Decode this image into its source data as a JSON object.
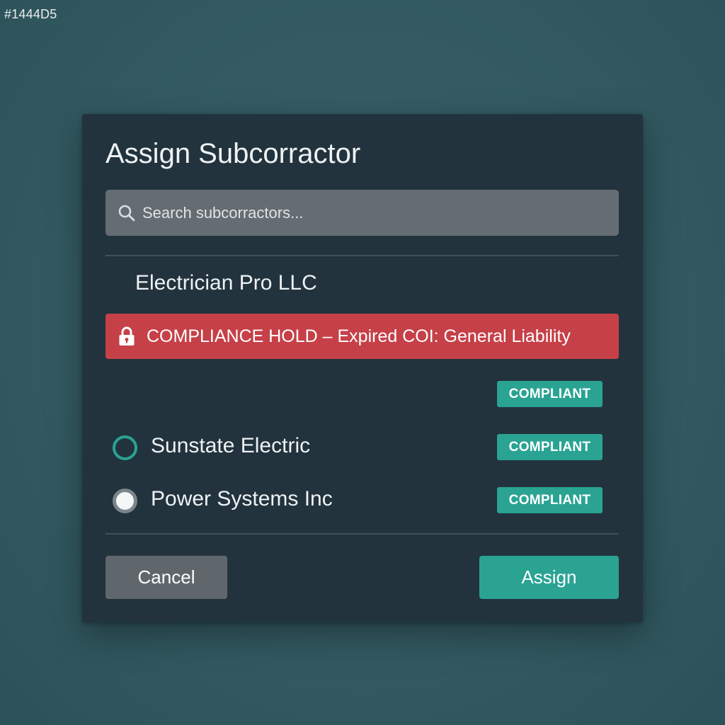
{
  "corner_text": "#1444D5",
  "dialog": {
    "title": "Assign Subcorractor",
    "search": {
      "placeholder": "Search subcorractors...",
      "value": "",
      "icon": "search-icon"
    },
    "selected_company": "Electrician Pro LLC",
    "compliance_hold": {
      "icon": "lock-icon",
      "text": "COMPLIANCE HOLD – Expired COI: General Liability",
      "color": "#c64048"
    },
    "standalone_badge": "COMPLIANT",
    "options": [
      {
        "label": "Sunstate Electric",
        "badge": "COMPLIANT",
        "radio_style": "teal-ring"
      },
      {
        "label": "Power Systems Inc",
        "badge": "COMPLIANT",
        "radio_style": "grey-filled"
      }
    ],
    "buttons": {
      "cancel": "Cancel",
      "assign": "Assign"
    },
    "colors": {
      "accent": "#2aa393",
      "dialog_bg": "#22333d",
      "page_bg": "#335a62"
    }
  }
}
